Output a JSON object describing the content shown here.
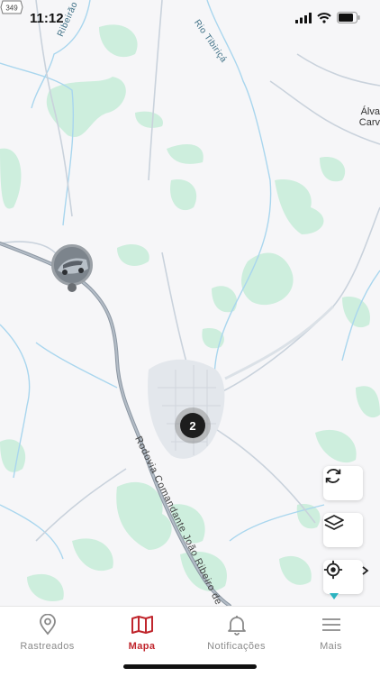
{
  "status_bar": {
    "time": "11:12"
  },
  "map": {
    "labels": {
      "ribeirao_ipiranga": "Ribeirão Ipiranga",
      "rio_tibirica": "Rio Tibiriçá",
      "town": "Álva\nCarv",
      "road": "Rodovia Comandante João Ribeiro de Barros",
      "route_shield": "349"
    },
    "cluster_count": "2"
  },
  "controls": {
    "refresh_icon": "refresh-icon",
    "layers_icon": "layers-icon",
    "locate_icon": "locate-icon"
  },
  "tabs": [
    {
      "label": "Rastreados",
      "icon": "location-pin-icon",
      "active": false
    },
    {
      "label": "Mapa",
      "icon": "map-icon",
      "active": true
    },
    {
      "label": "Notificações",
      "icon": "bell-icon",
      "active": false
    },
    {
      "label": "Mais",
      "icon": "menu-icon",
      "active": false
    }
  ],
  "colors": {
    "accent": "#c0262d",
    "vegetation": "#cdeedd",
    "water": "#a9d6ee",
    "road": "#8c97a3"
  }
}
